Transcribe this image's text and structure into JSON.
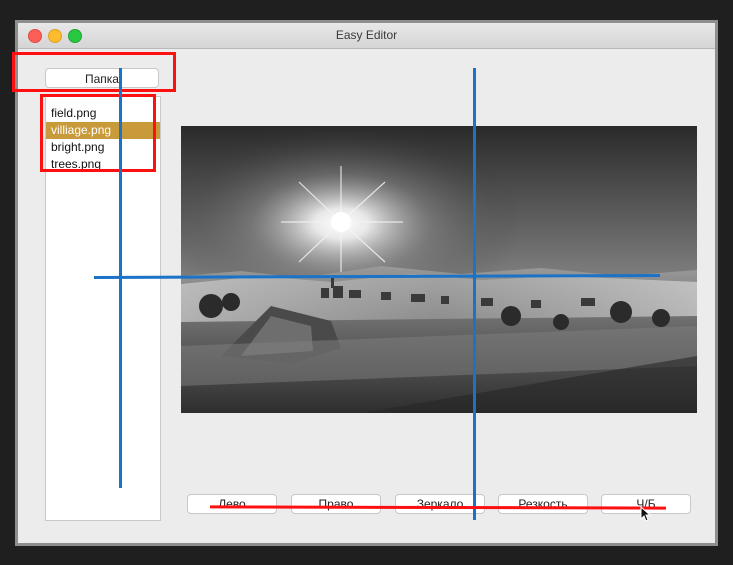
{
  "window": {
    "title": "Easy Editor"
  },
  "folder_button": {
    "label": "Папка"
  },
  "files": [
    {
      "name": "field.png",
      "selected": false
    },
    {
      "name": "villiage.png",
      "selected": true
    },
    {
      "name": "bright.png",
      "selected": false
    },
    {
      "name": "trees.png",
      "selected": false
    }
  ],
  "buttons": {
    "left": "Лево",
    "right": "Право",
    "mirror": "Зеркало",
    "sharpness": "Резкость",
    "bw": "Ч/Б"
  },
  "colors": {
    "annotation_red": "#ff1010",
    "annotation_blue": "#1a73c8",
    "selection": "#c99a3a"
  }
}
